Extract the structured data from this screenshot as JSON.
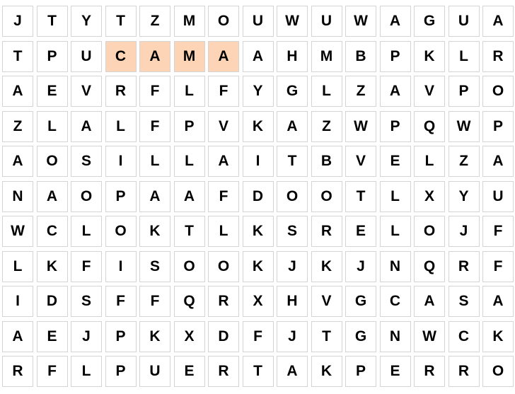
{
  "puzzle": {
    "rows": [
      [
        "J",
        "T",
        "Y",
        "T",
        "Z",
        "M",
        "O",
        "U",
        "W",
        "U",
        "W",
        "A",
        "G",
        "U",
        "A"
      ],
      [
        "T",
        "P",
        "U",
        "C",
        "A",
        "M",
        "A",
        "A",
        "H",
        "M",
        "B",
        "P",
        "K",
        "L",
        "R"
      ],
      [
        "A",
        "E",
        "V",
        "R",
        "F",
        "L",
        "F",
        "Y",
        "G",
        "L",
        "Z",
        "A",
        "V",
        "P",
        "O"
      ],
      [
        "Z",
        "L",
        "A",
        "L",
        "F",
        "P",
        "V",
        "K",
        "A",
        "Z",
        "W",
        "P",
        "Q",
        "W",
        "P"
      ],
      [
        "A",
        "O",
        "S",
        "I",
        "L",
        "L",
        "A",
        "I",
        "T",
        "B",
        "V",
        "E",
        "L",
        "Z",
        "A"
      ],
      [
        "N",
        "A",
        "O",
        "P",
        "A",
        "A",
        "F",
        "D",
        "O",
        "O",
        "T",
        "L",
        "X",
        "Y",
        "U"
      ],
      [
        "W",
        "C",
        "L",
        "O",
        "K",
        "T",
        "L",
        "K",
        "S",
        "R",
        "E",
        "L",
        "O",
        "J",
        "F"
      ],
      [
        "L",
        "K",
        "F",
        "I",
        "S",
        "O",
        "O",
        "K",
        "J",
        "K",
        "J",
        "N",
        "Q",
        "R",
        "F"
      ],
      [
        "I",
        "D",
        "S",
        "F",
        "F",
        "Q",
        "R",
        "X",
        "H",
        "V",
        "G",
        "C",
        "A",
        "S",
        "A"
      ],
      [
        "A",
        "E",
        "J",
        "P",
        "K",
        "X",
        "D",
        "F",
        "J",
        "T",
        "G",
        "N",
        "W",
        "C",
        "K"
      ],
      [
        "R",
        "F",
        "L",
        "P",
        "U",
        "E",
        "R",
        "T",
        "A",
        "K",
        "P",
        "E",
        "R",
        "R",
        "O"
      ]
    ],
    "found_words": [
      {
        "cells": [
          [
            1,
            3
          ],
          [
            1,
            4
          ],
          [
            1,
            5
          ],
          [
            1,
            6
          ]
        ]
      }
    ]
  },
  "colors": {
    "highlight": "#fdd5b6",
    "cell_border": "#d4d4d4",
    "cell_background": "#ffffff",
    "letter": "#000000"
  }
}
